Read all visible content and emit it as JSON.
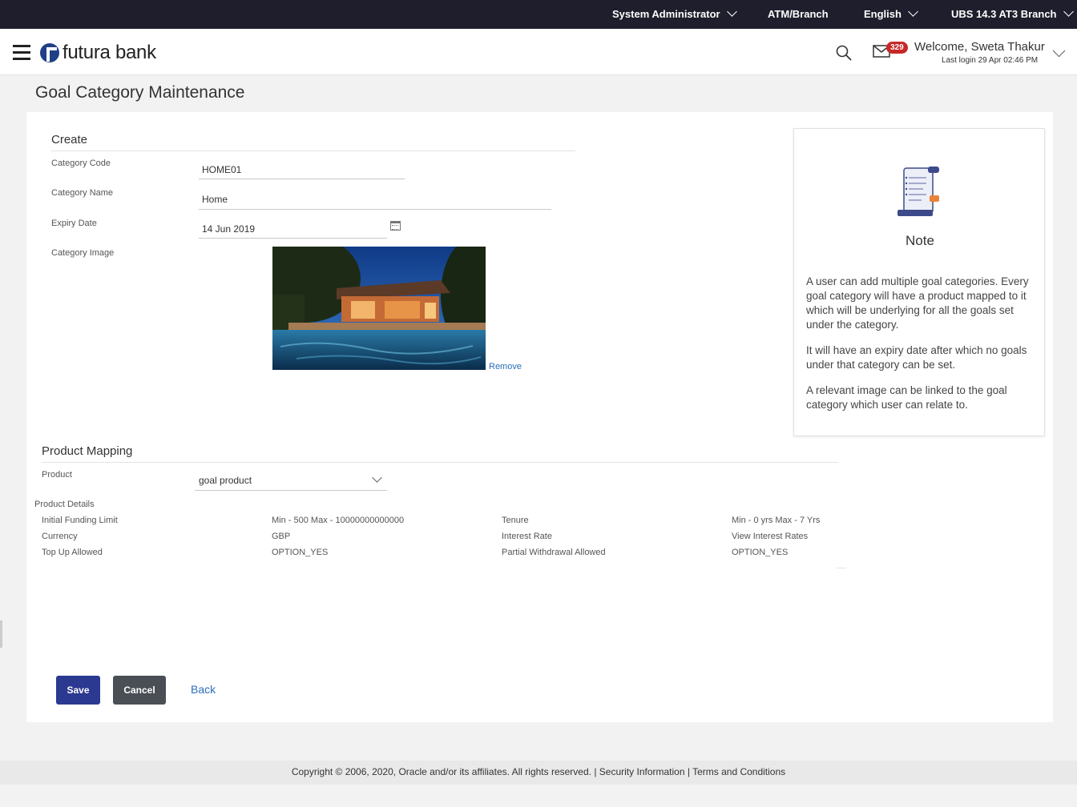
{
  "topbar": {
    "role": "System Administrator",
    "location": "ATM/Branch",
    "language": "English",
    "branch": "UBS 14.3 AT3 Branch"
  },
  "header": {
    "brand": "futura bank",
    "mail_count": "329",
    "welcome": "Welcome, Sweta Thakur",
    "last_login": "Last login 29 Apr 02:46 PM"
  },
  "page": {
    "title": "Goal Category Maintenance"
  },
  "create": {
    "section_title": "Create",
    "category_code_label": "Category Code",
    "category_code_value": "HOME01",
    "category_name_label": "Category Name",
    "category_name_value": "Home",
    "expiry_date_label": "Expiry Date",
    "expiry_date_value": "14 Jun 2019",
    "category_image_label": "Category Image",
    "remove_label": "Remove"
  },
  "note": {
    "title": "Note",
    "paragraphs": [
      "A user can add multiple goal categories. Every goal category will have a product mapped to it which will be underlying for all the goals set under the category.",
      "It will have an expiry date after which no goals under that category can be set.",
      "A relevant image can be linked to the goal category which user can relate to."
    ]
  },
  "product_mapping": {
    "section_title": "Product Mapping",
    "product_label": "Product",
    "product_value": "goal product",
    "details_title": "Product Details",
    "details": [
      {
        "label": "Initial Funding Limit",
        "value": "Min - 500 Max - 10000000000000"
      },
      {
        "label": "Tenure",
        "value": "Min - 0 yrs Max - 7 Yrs"
      },
      {
        "label": "Currency",
        "value": "GBP"
      },
      {
        "label": "Interest Rate",
        "value": "View Interest Rates"
      },
      {
        "label": "Top Up Allowed",
        "value": "OPTION_YES"
      },
      {
        "label": "Partial Withdrawal Allowed",
        "value": "OPTION_YES"
      }
    ]
  },
  "actions": {
    "save": "Save",
    "cancel": "Cancel",
    "back": "Back"
  },
  "footer": {
    "copyright": "Copyright © 2006, 2020, Oracle and/or its affiliates. All rights reserved.",
    "security": "Security Information",
    "terms": "Terms and Conditions"
  },
  "colors": {
    "topbar": "#1e1e2d",
    "primary_button": "#2b3990",
    "secondary_button": "#4a4e55",
    "link": "#2a6ebb",
    "badge": "#c62828"
  }
}
